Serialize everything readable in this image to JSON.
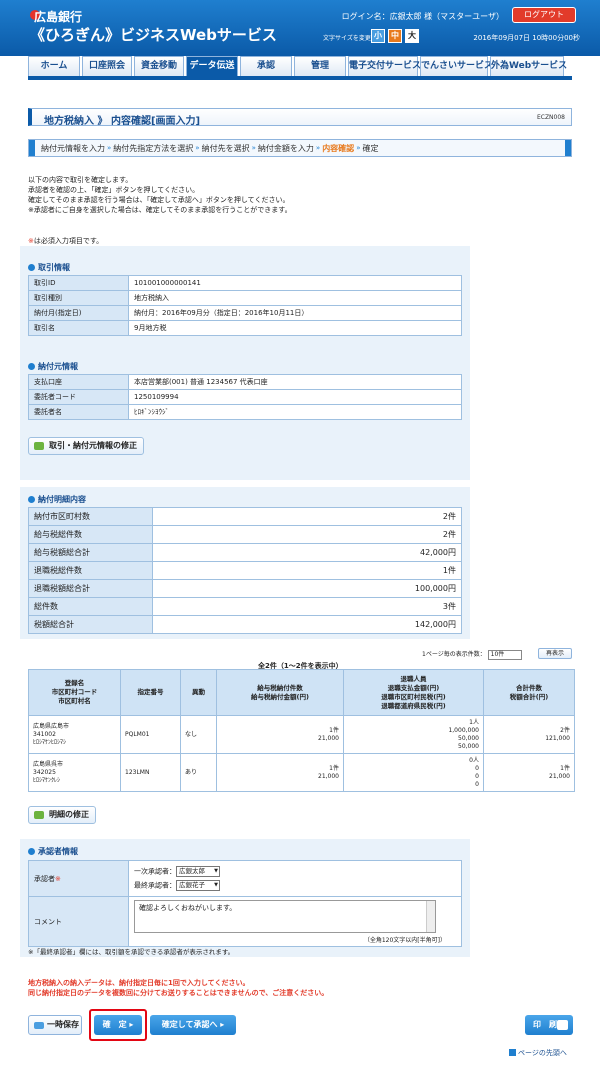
{
  "header": {
    "bank_name": "広島銀行",
    "service_name": "《ひろぎん》ビジネスWebサービス",
    "login_name": "ログイン名：広銀太郎 様（マスターユーザ）",
    "logout_label": "ログアウト",
    "font_size_label": "文字サイズを変更",
    "font_small": "小",
    "font_medium": "中",
    "font_large": "大",
    "datetime": "2016年09月07日 10時00分00秒"
  },
  "nav": {
    "tabs": [
      {
        "label": "ホーム"
      },
      {
        "label": "口座照会"
      },
      {
        "label": "資金移動"
      },
      {
        "label": "データ伝送"
      },
      {
        "label": "承認"
      },
      {
        "label": "管理"
      },
      {
        "label": "電子交付サービス"
      },
      {
        "label": "でんさいサービス"
      },
      {
        "label": "外為Webサービス"
      }
    ],
    "active": "データ伝送"
  },
  "page": {
    "title": "地方税納入 》 内容確認[画面入力]",
    "screen_id": "ECZN008"
  },
  "steps": [
    {
      "label": "納付元情報を入力"
    },
    {
      "label": "納付先指定方法を選択"
    },
    {
      "label": "納付先を選択"
    },
    {
      "label": "納付金額を入力"
    },
    {
      "label": "内容確認"
    },
    {
      "label": "確定"
    }
  ],
  "intro": {
    "line1": "以下の内容で取引を確定します。",
    "line2": "承認者を確認の上、「確定」ボタンを押してください。",
    "line3": "確定してそのまま承認を行う場合は、「確定して承認へ」ボタンを押してください。",
    "line4": "※承認者にご自身を選択した場合は、確定してそのまま承認を行うことができます。"
  },
  "required_note": {
    "mark": "※",
    "text": "は必須入力項目です。"
  },
  "transaction_info": {
    "heading": "取引情報",
    "rows": [
      {
        "label": "取引ID",
        "value": "101001000000141"
      },
      {
        "label": "取引種別",
        "value": "地方税納入"
      },
      {
        "label": "納付月(指定日)",
        "value": "納付月：2016年09月分（指定日：2016年10月11日）"
      },
      {
        "label": "取引名",
        "value": "9月地方税"
      }
    ]
  },
  "payer_info": {
    "heading": "納付元情報",
    "rows": [
      {
        "label": "支払口座",
        "value": "本店営業部(001) 普通 1234567 代表口座"
      },
      {
        "label": "委託者コード",
        "value": "1250109994"
      },
      {
        "label": "委託者名",
        "value": "ﾋﾛｷﾞﾝｼﾖｳｼﾞ"
      }
    ],
    "fix_button": "取引・納付元情報の修正"
  },
  "payment_detail": {
    "heading": "納付明細内容",
    "rows": [
      {
        "label": "納付市区町村数",
        "value": "2件"
      },
      {
        "label": "給与税総件数",
        "value": "2件"
      },
      {
        "label": "給与税額総合計",
        "value": "42,000円"
      },
      {
        "label": "退職税総件数",
        "value": "1件"
      },
      {
        "label": "退職税額総合計",
        "value": "100,000円"
      },
      {
        "label": "総件数",
        "value": "3件"
      },
      {
        "label": "税額総合計",
        "value": "142,000円"
      }
    ]
  },
  "list": {
    "per_page_label": "1ページ毎の表示件数：",
    "per_page_value": "10件",
    "redisplay_label": "再表示",
    "total_count": "全2件（1〜2件を表示中）",
    "headers": {
      "h1a": "登録名",
      "h1b": "市区町村コード",
      "h1c": "市区町村名",
      "h2": "指定番号",
      "h3": "異動",
      "h4a": "給与税納付件数",
      "h4b": "給与税納付金額(円)",
      "h5a": "退職人員",
      "h5b": "退職支払金額(円)",
      "h5c": "退職市区町村民税(円)",
      "h5d": "退職都道府県民税(円)",
      "h6a": "合計件数",
      "h6b": "税額合計(円)"
    },
    "rows": [
      {
        "reg_name": "広島県広島市",
        "city_code": "341002",
        "city_name": "ﾋﾛｼﾏｹﾝﾋﾛｼﾏｼ",
        "number": "PQLM01",
        "change": "なし",
        "salary_count": "1件",
        "salary_amount": "21,000",
        "ret_people": "1人",
        "ret_paid": "1,000,000",
        "ret_city": "50,000",
        "ret_pref": "50,000",
        "total_count": "2件",
        "total_amount": "121,000"
      },
      {
        "reg_name": "広島県呉市",
        "city_code": "342025",
        "city_name": "ﾋﾛｼﾏｹﾝｸﾚｼ",
        "number": "123LMN",
        "change": "あり",
        "salary_count": "1件",
        "salary_amount": "21,000",
        "ret_people": "0人",
        "ret_paid": "0",
        "ret_city": "0",
        "ret_pref": "0",
        "total_count": "1件",
        "total_amount": "21,000"
      }
    ],
    "fix_button": "明細の修正"
  },
  "approver": {
    "heading": "承認者情報",
    "label": "承認者",
    "required_mark": "※",
    "first_label": "一次承認者：",
    "first_value": "広銀太郎",
    "final_label": "最終承認者：",
    "final_value": "広銀花子",
    "comment_label": "コメント",
    "comment_value": "確認よろしくおねがいします。",
    "comment_limit": "（全角120文字以内[半角可]）",
    "footnote": "※「最終承認者」欄には、取引額を承認できる承認者が表示されます。"
  },
  "warning": {
    "line1": "地方税納入の納入データは、納付指定日毎に1回で入力してください。",
    "line2": "同じ納付指定日のデータを複数回に分けてお送りすることはできませんので、ご注意ください。"
  },
  "buttons": {
    "save": "一時保存",
    "confirm": "確　定",
    "confirm_approve": "確定して承認へ",
    "print": "印　刷",
    "page_top": "ページの先頭へ"
  }
}
